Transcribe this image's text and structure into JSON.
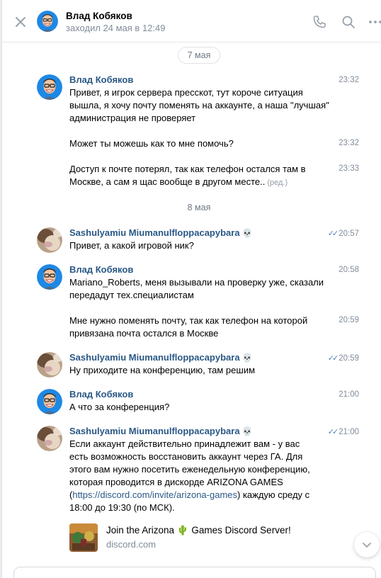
{
  "header": {
    "name": "Влад Кобяков",
    "status": "заходил 24 мая в 12:49",
    "close_icon": "close-icon",
    "call_icon": "phone-icon",
    "search_icon": "search-icon",
    "more_icon": "more-horizontal-icon"
  },
  "dates": [
    "7 мая",
    "8 мая"
  ],
  "messages": [
    {
      "author": "Влад Кобяков",
      "time": "23:32",
      "text": [
        "Привет, я игрок сервера пресскот, тут короче ситуация",
        "вышла, я хочу почту поменять на аккаунте, а наша \"лучшая\"",
        "администрация не проверяет"
      ]
    },
    {
      "time": "23:32",
      "text": [
        "Может ты можешь как то мне помочь?"
      ]
    },
    {
      "time": "23:33",
      "text": [
        "Доступ к почте потерял, так как телефон  остался там в",
        "Москве, а сам я щас вообще в другом месте.."
      ],
      "edited": "(ред.)"
    },
    {
      "author": "Sashulyamiu Miumanulfloppacapybara",
      "author_emoji": "💀",
      "time": "20:57",
      "text": [
        "Привет, а какой игровой ник?"
      ]
    },
    {
      "author": "Влад Кобяков",
      "time": "20:58",
      "text": [
        "Mariano_Roberts, меня вызывали на проверку уже, сказали",
        "передадут тех.специалистам"
      ]
    },
    {
      "time": "20:59",
      "text": [
        "Мне нужно поменять почту, так как телефон на которой",
        "привязана почта остался в Москве"
      ]
    },
    {
      "author": "Sashulyamiu Miumanulfloppacapybara",
      "author_emoji": "💀",
      "time": "20:59",
      "text": [
        "Ну приходите на конференцию, там решим"
      ]
    },
    {
      "author": "Влад Кобяков",
      "time": "21:00",
      "text": [
        "А что за конференция?"
      ]
    },
    {
      "author": "Sashulyamiu Miumanulfloppacapybara",
      "author_emoji": "💀",
      "time": "21:00",
      "text": [
        "Если аккаунт действительно принадлежит вам - у вас",
        "есть возможность восстановить аккаунт через ГА. Для",
        "этого вам нужно посетить еженедельную конференцию,",
        "которая проводится в дискорде ARIZONA GAMES"
      ],
      "text_link_open": "(",
      "link": "https://discord.com/invite/arizona-games",
      "text_link_close": ") каждую среду с",
      "text_last": "18:00 до 19:30 (по МСК)."
    }
  ],
  "snippet": {
    "title_before": "Join the Arizona",
    "title_emoji": "🌵",
    "title_after": "Games Discord Server!",
    "domain": "discord.com"
  },
  "composer": {
    "placeholder": ""
  },
  "colors": {
    "link": "#2a5885",
    "muted": "#818c99",
    "read_checks": "#5181b8",
    "border": "#e7e8ec"
  }
}
